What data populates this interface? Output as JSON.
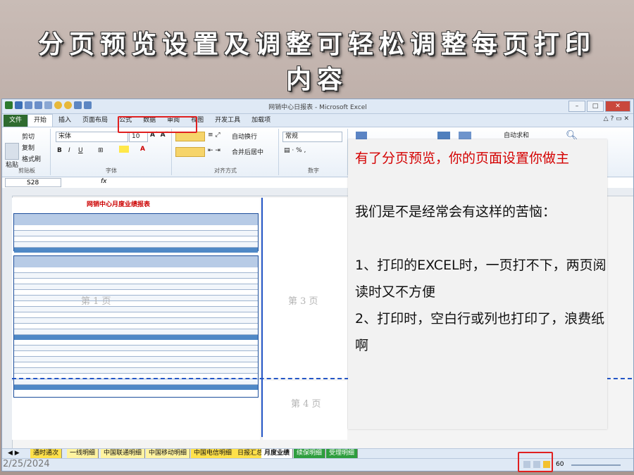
{
  "slide_title": "分页预览设置及调整可轻松调整每页打印内容",
  "date": "2/25/2024",
  "excel": {
    "window_title": "网销中心日报表 - Microsoft Excel",
    "tabs": [
      "文件",
      "开始",
      "插入",
      "页面布局",
      "公式",
      "数据",
      "审阅",
      "视图",
      "开发工具",
      "加载项"
    ],
    "active_tab": "开始",
    "ribbon": {
      "clipboard": {
        "cut": "剪切",
        "copy": "复制",
        "format_painter": "格式刷",
        "paste": "粘贴",
        "label": "剪贴板"
      },
      "font": {
        "name": "宋体",
        "size": "10",
        "label": "字体"
      },
      "alignment": {
        "wrap": "自动换行",
        "merge": "合并后居中",
        "label": "对齐方式"
      },
      "number": {
        "format": "常规",
        "label": "数字"
      },
      "editing": {
        "autosum": "自动求和"
      }
    },
    "name_box": "S28",
    "fx": "fx",
    "report_title": "网销中心月度业绩报表",
    "page_labels": [
      "第 1 页",
      "第 3 页",
      "第 4 页"
    ],
    "sheet_tabs": [
      "通时通次",
      "一线明细",
      "中国联通明细",
      "中国移动明细",
      "中国电信明细",
      "日报汇总",
      "月度业绩",
      "续保明细",
      "受理明细"
    ],
    "active_sheet": "月度业绩",
    "zoom": "60"
  },
  "note": {
    "heading": "有了分页预览，你的页面设置你做主",
    "lines": [
      "我们是不是经常会有这样的苦恼：",
      "1、打印的EXCEL时，一页打不下，两页阅读时又不方便",
      "2、打印时，空白行或列也打印了，浪费纸啊"
    ]
  }
}
